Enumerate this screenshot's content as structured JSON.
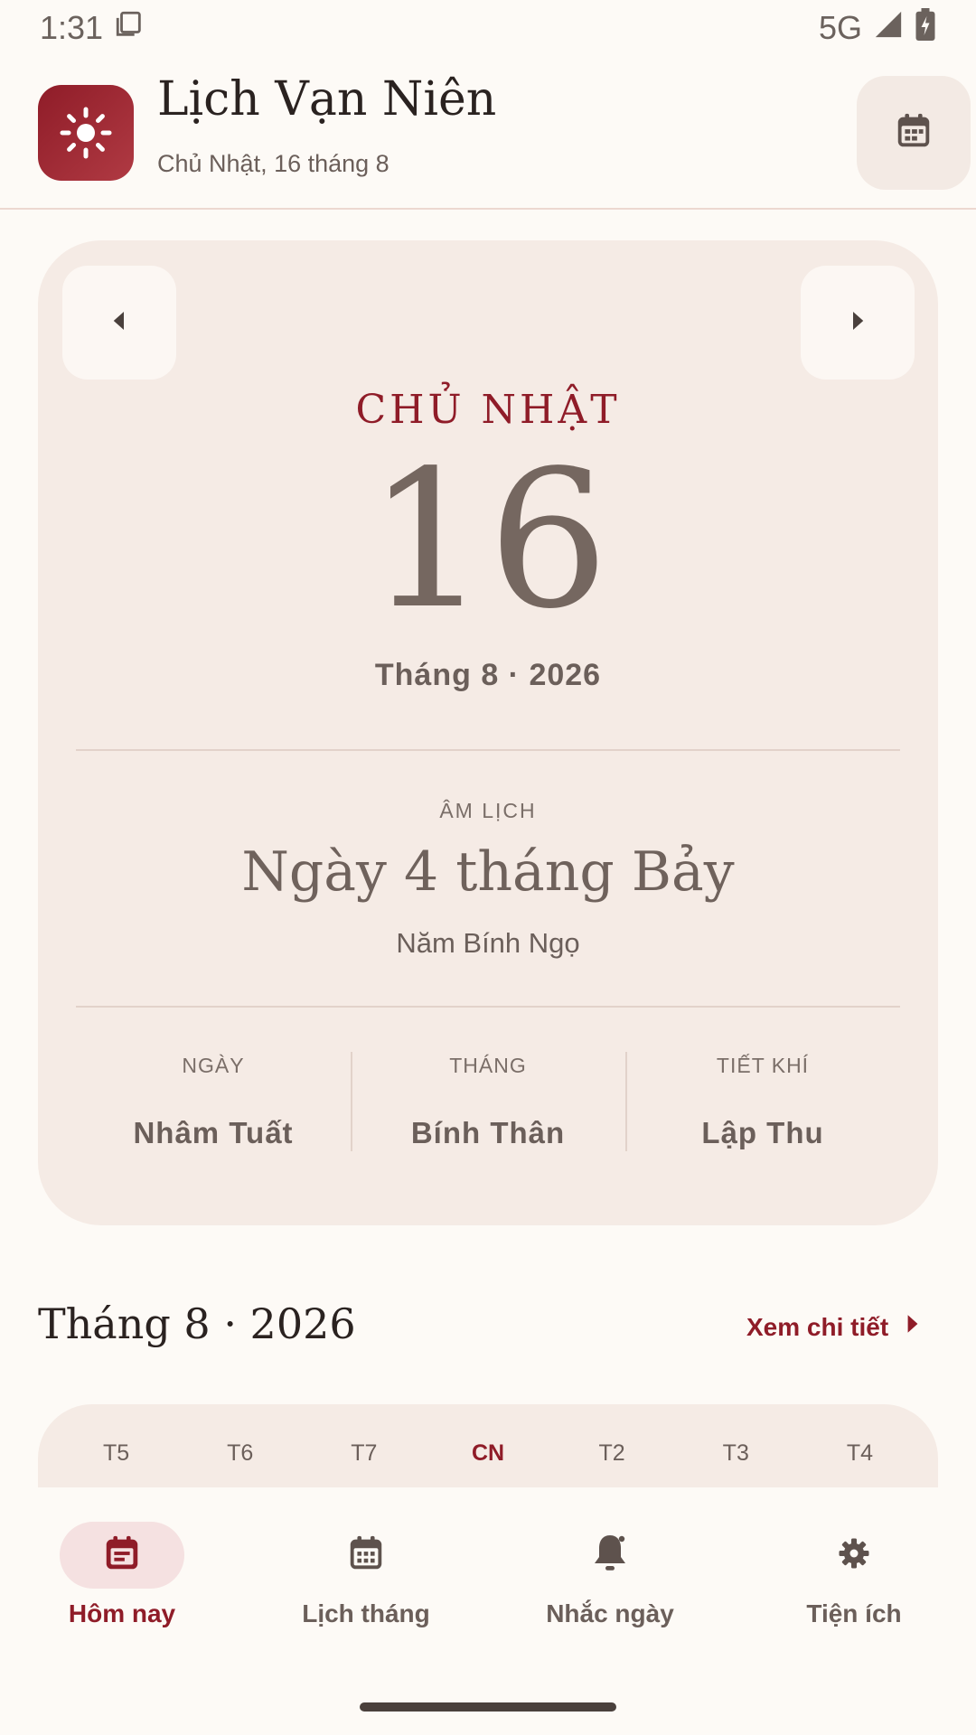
{
  "status_bar": {
    "time": "1:31",
    "network": "5G"
  },
  "header": {
    "title": "Lịch Vạn Niên",
    "subtitle": "Chủ Nhật, 16 tháng 8"
  },
  "day_card": {
    "weekday": "CHỦ NHẬT",
    "day": "16",
    "month_year": "Tháng 8 · 2026",
    "lunar_label": "ÂM LỊCH",
    "lunar_date": "Ngày 4 tháng Bảy",
    "lunar_year": "Năm Bính Ngọ",
    "can_chi": [
      {
        "label": "NGÀY",
        "value": "Nhâm Tuất"
      },
      {
        "label": "THÁNG",
        "value": "Bính Thân"
      },
      {
        "label": "TIẾT KHÍ",
        "value": "Lập Thu"
      }
    ]
  },
  "month_section": {
    "title": "Tháng 8 · 2026",
    "detail_link": "Xem chi tiết",
    "weekdays": [
      "T5",
      "T6",
      "T7",
      "CN",
      "T2",
      "T3",
      "T4"
    ]
  },
  "bottom_nav": {
    "items": [
      {
        "label": "Hôm nay",
        "active": true
      },
      {
        "label": "Lịch tháng",
        "active": false
      },
      {
        "label": "Nhắc ngày",
        "active": false
      },
      {
        "label": "Tiện ích",
        "active": false
      }
    ]
  },
  "colors": {
    "accent": "#8f1c28",
    "background": "#fdfaf6",
    "card": "#f5ebe5"
  }
}
